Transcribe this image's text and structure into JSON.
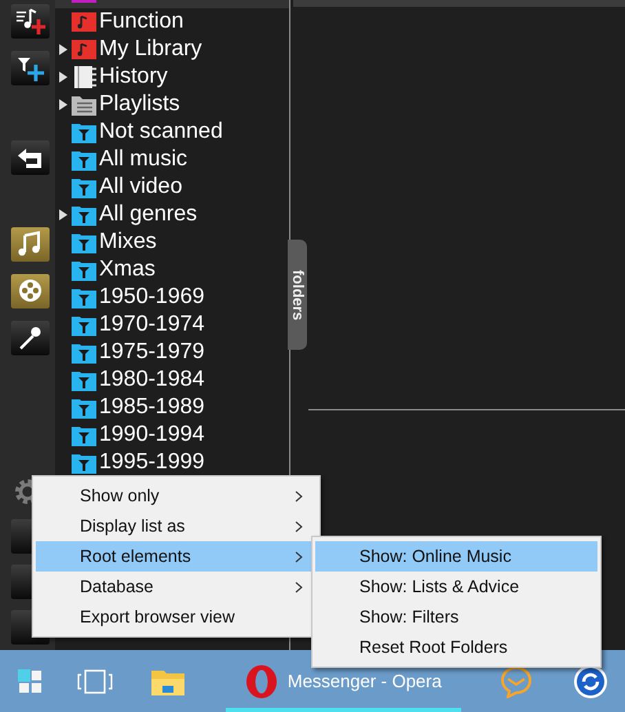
{
  "toolbar": {
    "top_buttons": [
      {
        "selected": false
      },
      {
        "selected": false
      },
      {
        "selected": false
      },
      {
        "selected": true
      },
      {
        "selected": true
      },
      {
        "selected": false
      }
    ],
    "bottom_buttons": [
      {
        "selected": false
      },
      {
        "selected": false
      },
      {
        "selected": false
      }
    ]
  },
  "tree": {
    "items": [
      {
        "kind": "ask"
      },
      {
        "label": "Function",
        "kind": "function",
        "expandable": false
      },
      {
        "label": "My Library",
        "kind": "library",
        "expandable": true
      },
      {
        "label": "History",
        "kind": "history",
        "expandable": true
      },
      {
        "label": "Playlists",
        "kind": "playlists",
        "expandable": true
      },
      {
        "label": "Not scanned",
        "kind": "filter",
        "expandable": false
      },
      {
        "label": "All music",
        "kind": "filter",
        "expandable": false
      },
      {
        "label": "All video",
        "kind": "filter",
        "expandable": false
      },
      {
        "label": "All genres",
        "kind": "filter",
        "expandable": true
      },
      {
        "label": "Mixes",
        "kind": "filter",
        "expandable": false
      },
      {
        "label": "Xmas",
        "kind": "filter",
        "expandable": false
      },
      {
        "label": "1950-1969",
        "kind": "filter",
        "expandable": false
      },
      {
        "label": "1970-1974",
        "kind": "filter",
        "expandable": false
      },
      {
        "label": "1975-1979",
        "kind": "filter",
        "expandable": false
      },
      {
        "label": "1980-1984",
        "kind": "filter",
        "expandable": false
      },
      {
        "label": "1985-1989",
        "kind": "filter",
        "expandable": false
      },
      {
        "label": "1990-1994",
        "kind": "filter",
        "expandable": false
      },
      {
        "label": "1995-1999",
        "kind": "filter",
        "expandable": false
      }
    ]
  },
  "side_tab": {
    "label": "folders"
  },
  "context_menu": {
    "items": [
      {
        "label": "Show only",
        "has_submenu": true,
        "selected": false
      },
      {
        "label": "Display list as",
        "has_submenu": true,
        "selected": false
      },
      {
        "label": "Root elements",
        "has_submenu": true,
        "selected": true
      },
      {
        "label": "Database",
        "has_submenu": true,
        "selected": false
      },
      {
        "label": "Export browser view",
        "has_submenu": false,
        "selected": false
      }
    ]
  },
  "submenu": {
    "items": [
      {
        "label": "Show: Online Music",
        "selected": true
      },
      {
        "label": "Show: Lists & Advice",
        "selected": false
      },
      {
        "label": "Show: Filters",
        "selected": false
      },
      {
        "label": "Reset Root Folders",
        "selected": false
      }
    ]
  },
  "taskbar": {
    "items": [
      {
        "kind": "start",
        "active": false
      },
      {
        "kind": "taskview",
        "active": false
      },
      {
        "kind": "explorer",
        "active": false
      },
      {
        "kind": "opera",
        "label": "Messenger - Opera",
        "active": true
      },
      {
        "kind": "mail",
        "active": false
      },
      {
        "kind": "sync",
        "active": false
      }
    ]
  }
}
